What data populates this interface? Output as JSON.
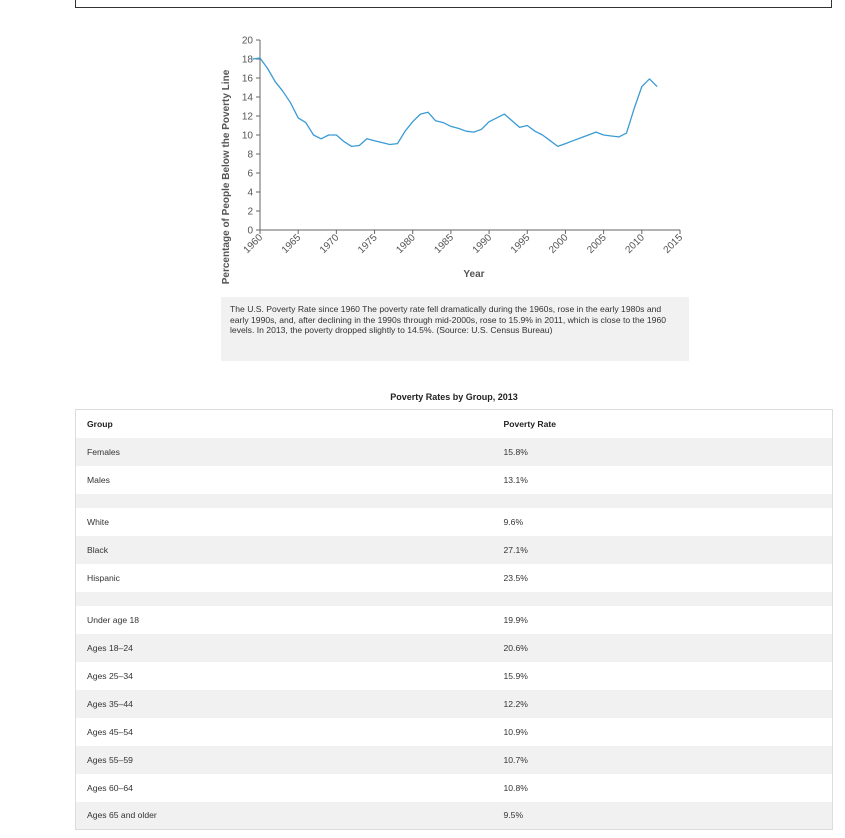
{
  "chart_data": {
    "type": "line",
    "xlabel": "Year",
    "ylabel": "Percentage of People Below the Poverty Line",
    "xlim": [
      1960,
      2015
    ],
    "ylim": [
      0,
      20
    ],
    "x_ticks": [
      "1960",
      "1965",
      "1970",
      "1975",
      "1980",
      "1985",
      "1990",
      "1995",
      "2000",
      "2005",
      "2010",
      "2015"
    ],
    "y_ticks": [
      "0",
      "2",
      "4",
      "6",
      "8",
      "10",
      "12",
      "14",
      "16",
      "18",
      "20"
    ],
    "line_color": "#3a9bd5",
    "series": [
      {
        "x": [
          1959,
          1960,
          1961,
          1962,
          1963,
          1964,
          1965,
          1966,
          1967,
          1968,
          1969,
          1970,
          1971,
          1972,
          1973,
          1974,
          1975,
          1976,
          1977,
          1978,
          1979,
          1980,
          1981,
          1982,
          1983,
          1984,
          1985,
          1986,
          1987,
          1988,
          1989,
          1990,
          1991,
          1992,
          1993,
          1994,
          1995,
          1996,
          1997,
          1998,
          1999,
          2000,
          2001,
          2002,
          2003,
          2004,
          2005,
          2006,
          2007,
          2008,
          2009,
          2010,
          2011,
          2012
        ],
        "y": [
          18.0,
          18.1,
          17.0,
          15.6,
          14.6,
          13.4,
          11.8,
          11.3,
          10.0,
          9.6,
          10.0,
          10.0,
          9.3,
          8.8,
          8.9,
          9.6,
          9.4,
          9.2,
          9.0,
          9.1,
          10.4,
          11.4,
          12.2,
          12.4,
          11.5,
          11.3,
          10.9,
          10.7,
          10.4,
          10.3,
          10.6,
          11.4,
          11.8,
          12.2,
          11.5,
          10.8,
          11.0,
          10.4,
          10.0,
          9.4,
          8.8,
          9.1,
          9.4,
          9.7,
          10.0,
          10.3,
          10.0,
          9.9,
          9.8,
          10.2,
          12.8,
          15.1,
          15.9,
          15.1
        ]
      }
    ]
  },
  "caption": "The U.S. Poverty Rate since 1960 The poverty rate fell dramatically during the 1960s, rose in the early 1980s and early 1990s, and, after declining in the 1990s through mid-2000s, rose to 15.9% in 2011, which is close to the 1960 levels. In 2013, the poverty dropped slightly to 14.5%. (Source: U.S. Census Bureau)",
  "table": {
    "title": "Poverty Rates by Group, 2013",
    "headers": [
      "Group",
      "Poverty Rate"
    ],
    "sections": [
      [
        [
          "Females",
          "15.8%"
        ],
        [
          "Males",
          "13.1%"
        ]
      ],
      [
        [
          "White",
          "9.6%"
        ],
        [
          "Black",
          "27.1%"
        ],
        [
          "Hispanic",
          "23.5%"
        ]
      ],
      [
        [
          "Under age 18",
          "19.9%"
        ],
        [
          "Ages 18–24",
          "20.6%"
        ],
        [
          "Ages 25–34",
          "15.9%"
        ],
        [
          "Ages 35–44",
          "12.2%"
        ],
        [
          "Ages 45–54",
          "10.9%"
        ],
        [
          "Ages 55–59",
          "10.7%"
        ],
        [
          "Ages 60–64",
          "10.8%"
        ],
        [
          "Ages 65 and older",
          "9.5%"
        ]
      ]
    ]
  }
}
